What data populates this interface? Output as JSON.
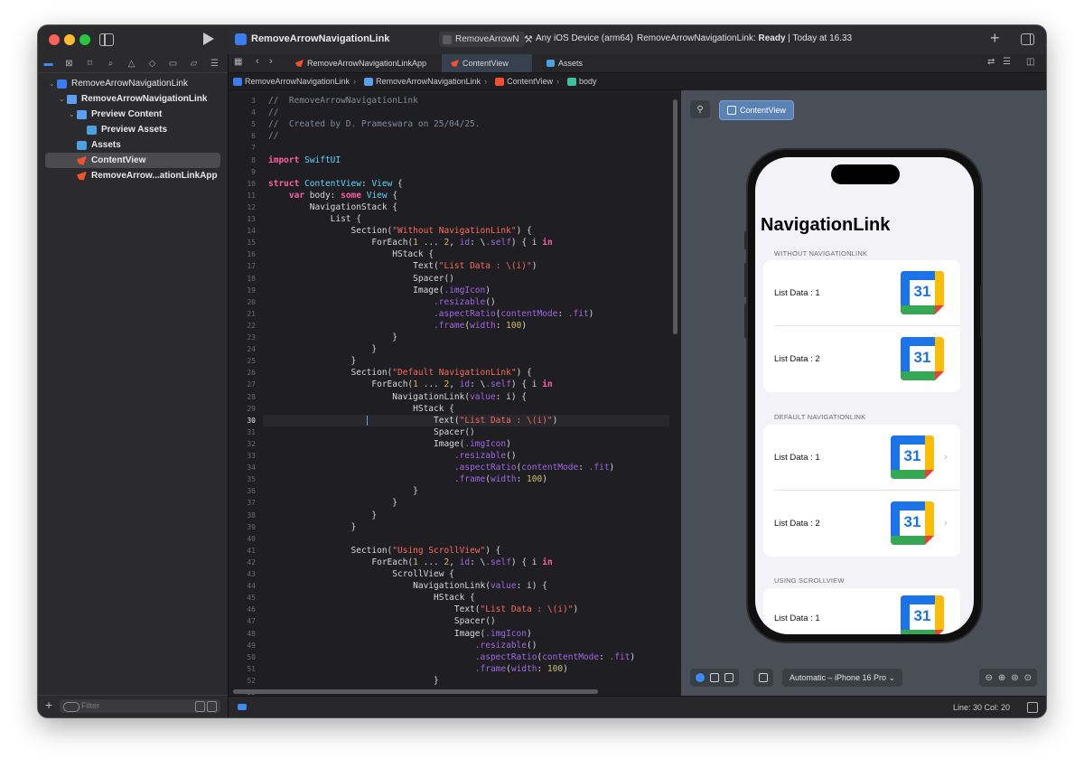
{
  "window": {
    "project_title": "RemoveArrowNavigationLink",
    "scheme": "RemoveArrowN",
    "device": "Any iOS Device (arm64)",
    "status_prefix": "RemoveArrowNavigationLink: ",
    "status_state": "Ready",
    "status_suffix": " | Today at 16.33"
  },
  "sidebar": {
    "items": [
      {
        "label": "RemoveArrowNavigationLink",
        "kind": "project"
      },
      {
        "label": "RemoveArrowNavigationLink",
        "kind": "folder"
      },
      {
        "label": "Preview Content",
        "kind": "folder"
      },
      {
        "label": "Preview Assets",
        "kind": "assets"
      },
      {
        "label": "Assets",
        "kind": "assets"
      },
      {
        "label": "ContentView",
        "kind": "swift"
      },
      {
        "label": "RemoveArrow...ationLinkApp",
        "kind": "swift"
      }
    ],
    "filter_placeholder": "Filter"
  },
  "tabs": [
    {
      "label": "RemoveArrowNavigationLinkApp"
    },
    {
      "label": "ContentView"
    },
    {
      "label": "Assets"
    }
  ],
  "jumpbar": {
    "project": "RemoveArrowNavigationLink",
    "group": "RemoveArrowNavigationLink",
    "file": "ContentView",
    "symbol": "body"
  },
  "editor": {
    "first_line": 3,
    "current_line": 30,
    "lines": [
      "//  RemoveArrowNavigationLink",
      "//",
      "//  Created by D. Prameswara on 25/04/25.",
      "//",
      "",
      "import SwiftUI",
      "",
      "struct ContentView: View {",
      "    var body: some View {",
      "        NavigationStack {",
      "            List {",
      "                Section(\"Without NavigationLink\") {",
      "                    ForEach(1 ... 2, id: \\.self) { i in",
      "                        HStack {",
      "                            Text(\"List Data : \\(i)\")",
      "                            Spacer()",
      "                            Image(.imgIcon)",
      "                                .resizable()",
      "                                .aspectRatio(contentMode: .fit)",
      "                                .frame(width: 100)",
      "                        }",
      "                    }",
      "                }",
      "                Section(\"Default NavigationLink\") {",
      "                    ForEach(1 ... 2, id: \\.self) { i in",
      "                        NavigationLink(value: i) {",
      "                            HStack {",
      "                                Text(\"List Data : \\(i)\")",
      "                                Spacer()",
      "                                Image(.imgIcon)",
      "                                    .resizable()",
      "                                    .aspectRatio(contentMode: .fit)",
      "                                    .frame(width: 100)",
      "                            }",
      "                        }",
      "                    }",
      "                }",
      "",
      "                Section(\"Using ScrollView\") {",
      "                    ForEach(1 ... 2, id: \\.self) { i in",
      "                        ScrollView {",
      "                            NavigationLink(value: i) {",
      "                                HStack {",
      "                                    Text(\"List Data : \\(i)\")",
      "                                    Spacer()",
      "                                    Image(.imgIcon)",
      "                                        .resizable()",
      "                                        .aspectRatio(contentMode: .fit)",
      "                                        .frame(width: 100)",
      "                                }",
      ""
    ]
  },
  "canvas": {
    "tab_label": "ContentView",
    "device_menu": "Automatic – iPhone 16 Pro ⌄",
    "preview": {
      "title": "NavigationLink",
      "sections": [
        {
          "header": "WITHOUT NAVIGATIONLINK",
          "rows": [
            "List Data : 1",
            "List Data : 2"
          ],
          "disclosure": false
        },
        {
          "header": "DEFAULT NAVIGATIONLINK",
          "rows": [
            "List Data : 1",
            "List Data : 2"
          ],
          "disclosure": true
        },
        {
          "header": "USING SCROLLVIEW",
          "rows": [
            "List Data : 1"
          ],
          "disclosure": false
        }
      ],
      "calendar_number": "31"
    }
  },
  "statusbar": {
    "position": "Line: 30  Col: 20"
  },
  "colors": {
    "accent": "#3d8cf5",
    "keyword": "#fc5fa3",
    "type": "#5dd8ff",
    "string": "#fc6a5d",
    "number": "#d0bf69"
  }
}
